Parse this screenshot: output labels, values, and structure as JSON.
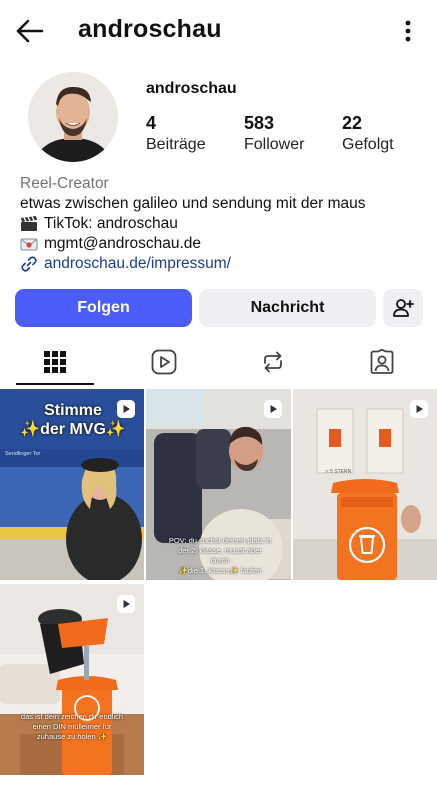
{
  "header": {
    "title": "androschau"
  },
  "profile": {
    "username": "androschau",
    "stats": [
      {
        "value": "4",
        "label": "Beiträge"
      },
      {
        "value": "583",
        "label": "Follower"
      },
      {
        "value": "22",
        "label": "Gefolgt"
      }
    ],
    "bio": {
      "category": "Reel-Creator",
      "line1": "etwas zwischen galileo und sendung mit der maus",
      "line2": "TikTok: androschau",
      "line3": "mgmt@androschau.de",
      "link": "androschau.de/impressum/"
    }
  },
  "actions": {
    "follow": "Folgen",
    "message": "Nachricht"
  },
  "posts": [
    {
      "overlay_title_1": "Stimme",
      "overlay_title_2": "✨der MVG✨",
      "sign": "Sendlinger Tor"
    },
    {
      "caption_1": "POV: du suchst deinen platz in",
      "caption_2": "der 2. klasse, musst aber durch",
      "caption_3": "✨die 1. klasse✨ laufen"
    },
    {
      "sign": "⛌ 5 STERN"
    },
    {
      "caption_1": "das ist dein zeichen dir endlich",
      "caption_2": "einen DIN mülleimer für",
      "caption_3": "zuhause zu holen ✨"
    }
  ],
  "colors": {
    "follow_button": "#4a5df9",
    "secondary_button": "#efeff3",
    "link": "#1e3c8c",
    "category": "#737373"
  }
}
